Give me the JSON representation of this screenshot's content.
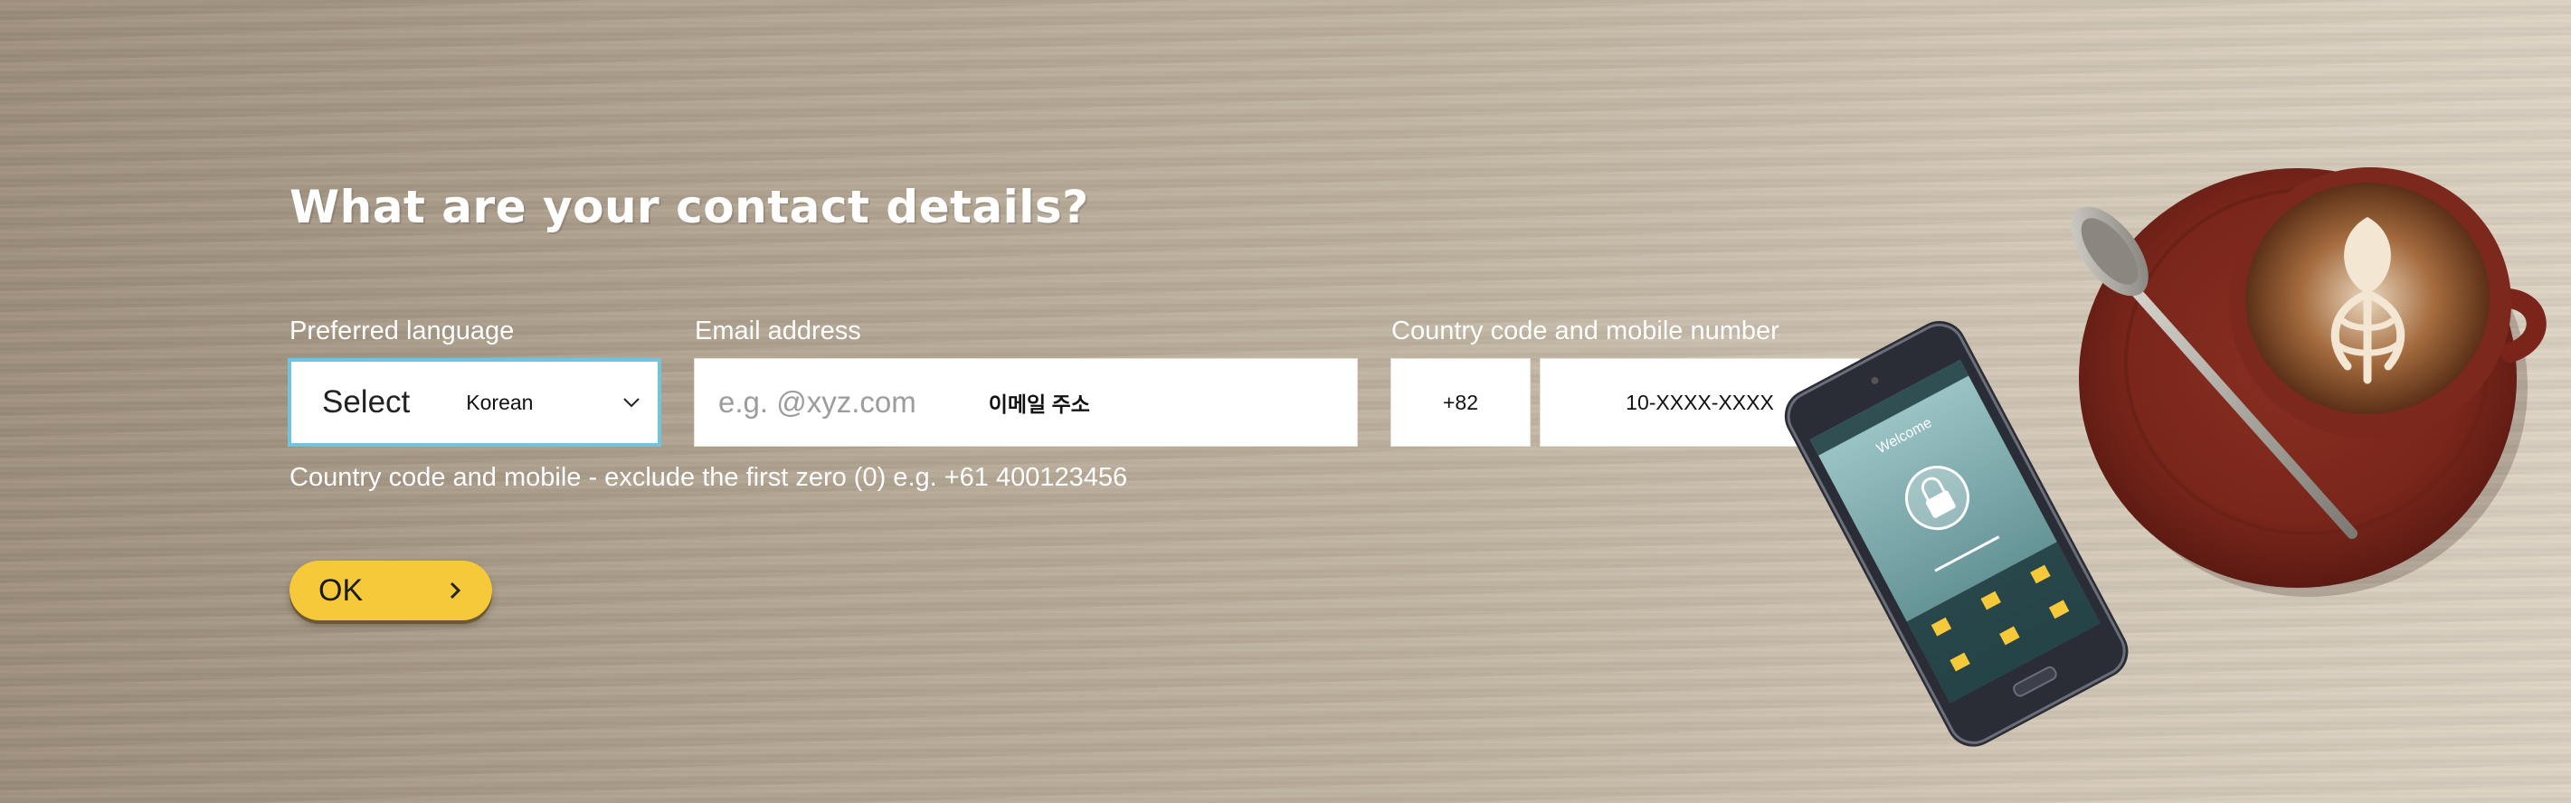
{
  "form": {
    "heading": "What are your contact details?",
    "language": {
      "label": "Preferred language",
      "select_text": "Select",
      "selected_value": "Korean"
    },
    "email": {
      "label": "Email address",
      "placeholder": "e.g. @xyz.com",
      "hint": "이메일 주소"
    },
    "mobile": {
      "label": "Country code and mobile number",
      "country_code": "+82",
      "number": "10-XXXX-XXXX"
    },
    "helper_text": "Country code and mobile - exclude the first zero (0) e.g. +61 400123456",
    "ok_button": {
      "label": "OK",
      "icon": "chevron-right-icon"
    }
  },
  "artwork": {
    "phone_screen_title": "Welcome"
  },
  "colors": {
    "button": "#f5c93a",
    "focus_border": "#70c4de"
  }
}
